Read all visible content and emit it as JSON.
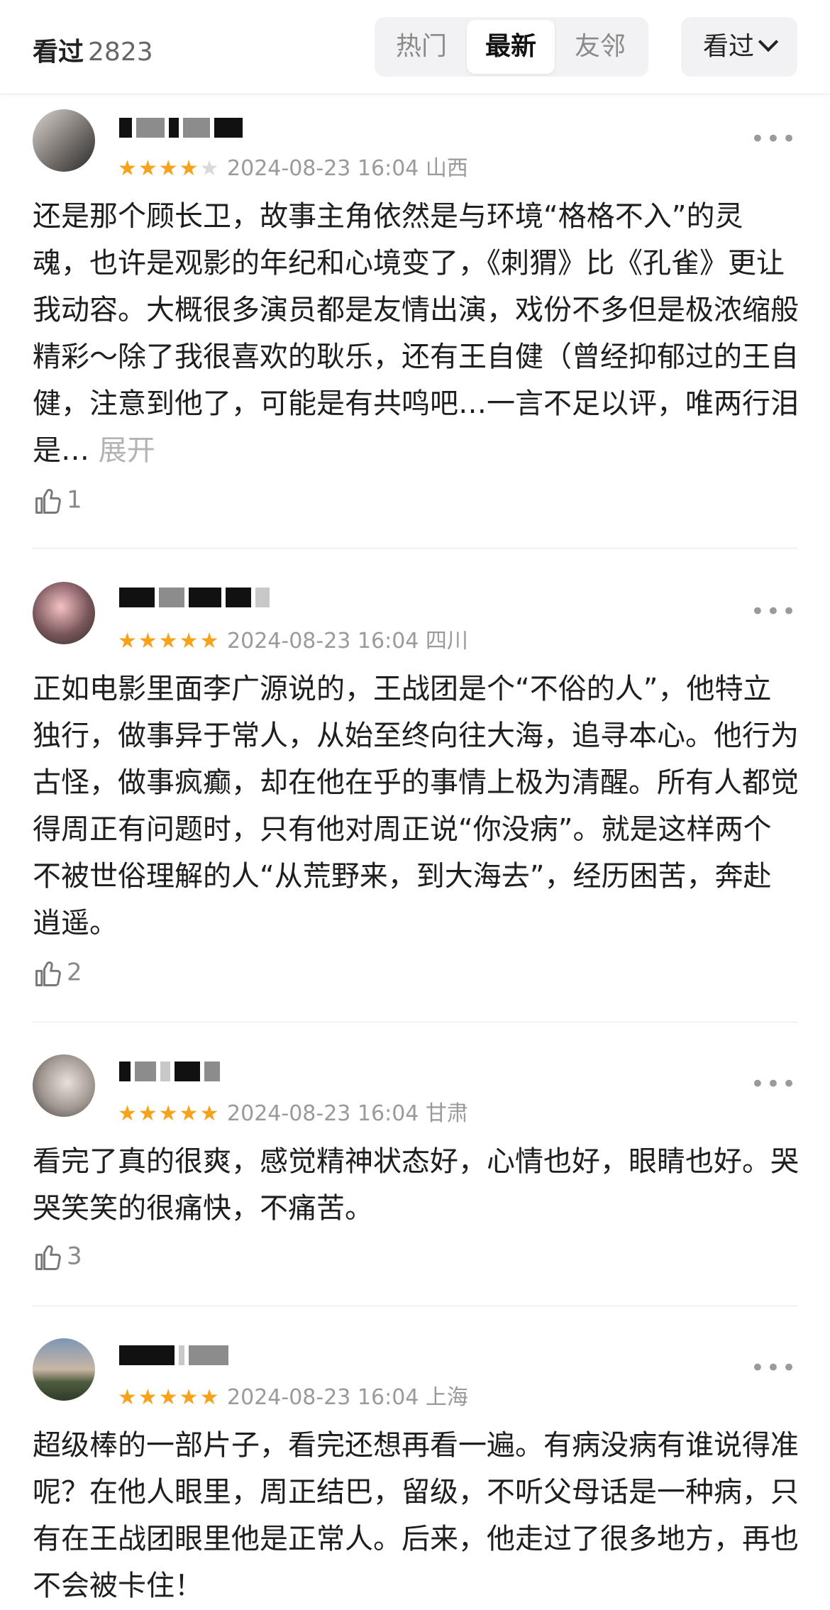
{
  "header": {
    "count_label": "看过",
    "count_value": "2823",
    "tabs": [
      "热门",
      "最新",
      "友邻"
    ],
    "active_tab": "最新",
    "filter_label": "看过"
  },
  "comments": [
    {
      "rating": 4,
      "stars_on": "★★★★",
      "stars_off": "★",
      "time": "2024-08-23 16:04",
      "location": "山西",
      "text": "还是那个顾长卫，故事主角依然是与环境“格格不入”的灵魂，也许是观影的年纪和心境变了，《刺猬》比《孔雀》更让我动容。大概很多演员都是友情出演，戏份不多但是极浓缩般精彩～除了我很喜欢的耿乐，还有王自健（曾经抑郁过的王自健，注意到他了，可能是有共鸣吧…一言不足以评，唯两行泪是…",
      "expand": "展开",
      "likes": "1"
    },
    {
      "rating": 5,
      "stars_on": "★★★★★",
      "stars_off": "",
      "time": "2024-08-23 16:04",
      "location": "四川",
      "text": "正如电影里面李广源说的，王战团是个“不俗的人”，他特立独行，做事异于常人，从始至终向往大海，追寻本心。他行为古怪，做事疯癫，却在他在乎的事情上极为清醒。所有人都觉得周正有问题时，只有他对周正说“你没病”。就是这样两个不被世俗理解的人“从荒野来，到大海去”，经历困苦，奔赴逍遥。",
      "expand": "",
      "likes": "2"
    },
    {
      "rating": 5,
      "stars_on": "★★★★★",
      "stars_off": "",
      "time": "2024-08-23 16:04",
      "location": "甘肃",
      "text": "看完了真的很爽，感觉精神状态好，心情也好，眼睛也好。哭哭笑笑的很痛快，不痛苦。",
      "expand": "",
      "likes": "3"
    },
    {
      "rating": 5,
      "stars_on": "★★★★★",
      "stars_off": "",
      "time": "2024-08-23 16:04",
      "location": "上海",
      "text": "超级棒的一部片子，看完还想再看一遍。有病没病有谁说得准呢？在他人眼里，周正结巴，留级，不听父母话是一种病，只有在王战团眼里他是正常人。后来，他走过了很多地方，再也不会被卡住！",
      "expand": "",
      "likes": ""
    }
  ],
  "icons": {
    "like": "thumbs-up-icon",
    "more": "more-dots-icon",
    "chevron": "chevron-down-icon"
  },
  "colors": {
    "star": "#f7a21b",
    "star_off": "#d9d9d9",
    "meta": "#9a9a9a"
  }
}
